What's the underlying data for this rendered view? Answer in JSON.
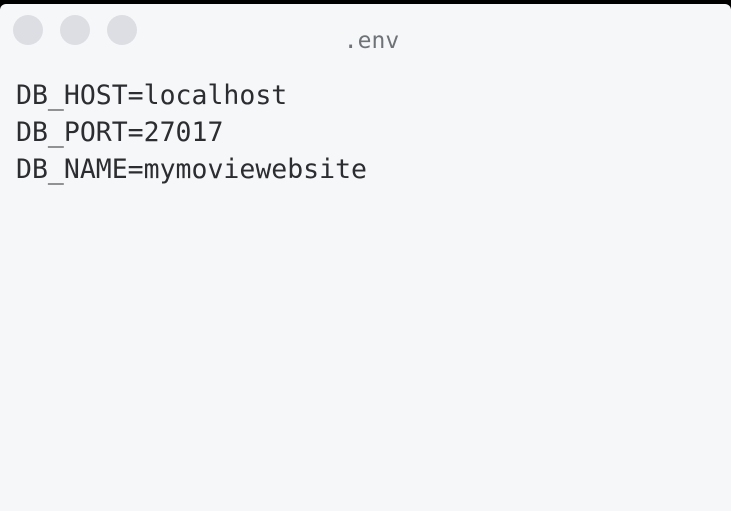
{
  "window": {
    "title": ".env",
    "buttons": [
      {
        "name": "close-button",
        "color": "#dcdee3"
      },
      {
        "name": "minimize-button",
        "color": "#dcdee3"
      },
      {
        "name": "maximize-button",
        "color": "#dcdee3"
      }
    ]
  },
  "editor": {
    "lines": [
      "DB_HOST=localhost",
      "DB_PORT=27017",
      "DB_NAME=mymoviewebsite"
    ]
  },
  "colors": {
    "background": "#f6f7f9",
    "text": "#2b2d30",
    "title_text": "#6f7378",
    "frame": "#000000"
  }
}
